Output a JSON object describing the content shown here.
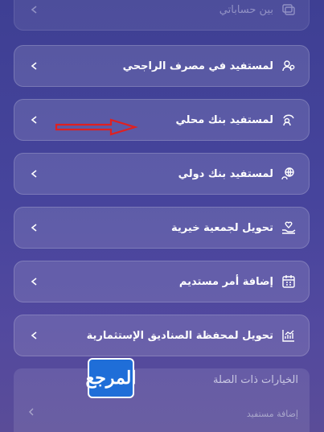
{
  "menu": {
    "items": [
      {
        "label": "بين حساباتي",
        "icon": "accounts-transfer-icon"
      },
      {
        "label": "لمستفيد في مصرف الراجحي",
        "icon": "beneficiary-alrajhi-icon"
      },
      {
        "label": "لمستفيد بنك محلي",
        "icon": "beneficiary-local-bank-icon"
      },
      {
        "label": "لمستفيد بنك دولي",
        "icon": "beneficiary-international-icon"
      },
      {
        "label": "تحويل لجمعية خيرية",
        "icon": "charity-icon"
      },
      {
        "label": "إضافة أمر مستديم",
        "icon": "standing-order-icon"
      },
      {
        "label": "تحويل لمحفظة الصناديق الإستثمارية",
        "icon": "investment-funds-icon"
      }
    ]
  },
  "related": {
    "title": "الخيارات ذات الصلة",
    "items": [
      {
        "label": "إضافة مستفيد"
      }
    ]
  },
  "logo": {
    "text": "المرجع"
  },
  "annotation": {
    "arrow_color": "#e02020"
  },
  "colors": {
    "bg_top": "#3e3f93",
    "bg_bottom": "#5a4c98",
    "text": "#ffffff"
  }
}
